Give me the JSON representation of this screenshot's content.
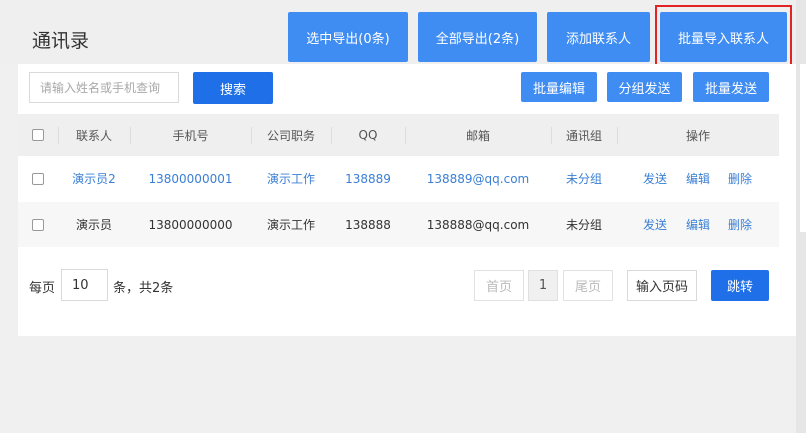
{
  "page": {
    "title": "通讯录"
  },
  "header_buttons": {
    "export_selected": "选中导出(0条)",
    "export_all": "全部导出(2条)",
    "add_contact": "添加联系人",
    "batch_import": "批量导入联系人"
  },
  "search": {
    "placeholder": "请输入姓名或手机查询",
    "button": "搜索"
  },
  "toolbar": {
    "batch_edit": "批量编辑",
    "group_send": "分组发送",
    "batch_send": "批量发送"
  },
  "table": {
    "headers": [
      "联系人",
      "手机号",
      "公司职务",
      "QQ",
      "邮箱",
      "通讯组",
      "操作"
    ],
    "rows": [
      {
        "name": "演示员2",
        "phone": "13800000001",
        "position": "演示工作",
        "qq": "138889",
        "email": "138889@qq.com",
        "group": "未分组"
      },
      {
        "name": "演示员",
        "phone": "13800000000",
        "position": "演示工作",
        "qq": "138888",
        "email": "138888@qq.com",
        "group": "未分组"
      }
    ],
    "actions": {
      "send": "发送",
      "edit": "编辑",
      "delete": "删除"
    }
  },
  "pagination": {
    "per_page_label": "每页",
    "per_page_value": "10",
    "total_label": "条，共2条",
    "first": "首页",
    "current": "1",
    "last": "尾页",
    "page_input": "输入页码",
    "jump": "跳转"
  },
  "colors": {
    "primary": "#3f8df2",
    "primary_dark": "#1e6fe8",
    "link": "#3a7fd5",
    "highlight": "#e12323"
  }
}
